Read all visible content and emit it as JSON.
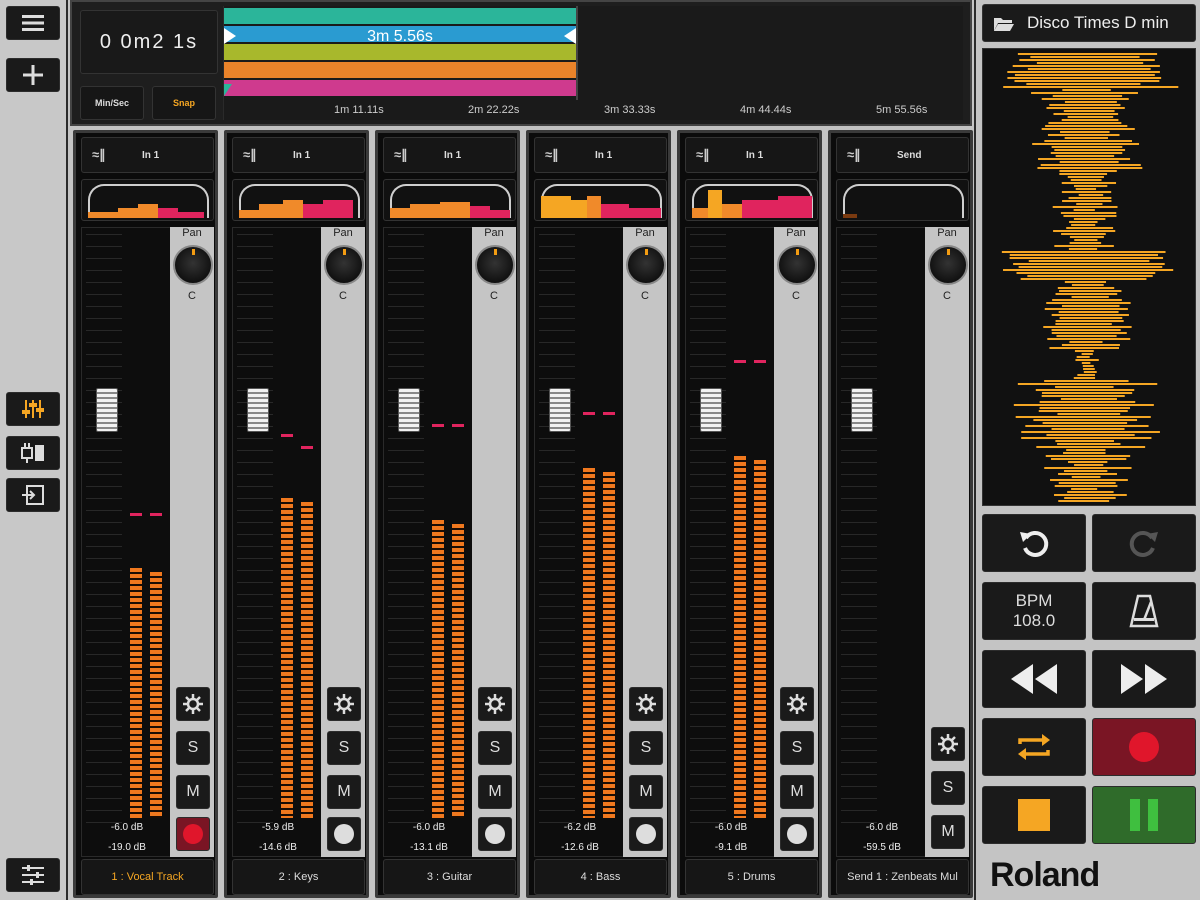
{
  "sidebar": {
    "items": [
      {
        "icon": "hamburger-menu-icon"
      },
      {
        "icon": "plus-icon"
      },
      {
        "icon": "mixer-sliders-icon"
      },
      {
        "icon": "plugin-icon"
      },
      {
        "icon": "export-icon"
      },
      {
        "icon": "list-settings-icon"
      }
    ]
  },
  "transport_time": {
    "display": "0 0m2 1s",
    "min_sec_label": "Min/Sec",
    "snap_label": "Snap"
  },
  "timeline": {
    "selection_label": "3m 5.56s",
    "ticks": [
      "1m 11.11s",
      "2m 22.22s",
      "3m 33.33s",
      "4m 44.44s",
      "5m 55.56s"
    ],
    "clip_colors": [
      "#2bb59a",
      "#2a9bd1",
      "#a8b82c",
      "#e9832a",
      "#cf3a8e"
    ]
  },
  "channels": [
    {
      "input": "In 1",
      "name": "1 : Vocal Track",
      "pan_label": "Pan",
      "pan_value": "C",
      "peak_db": "-6.0 dB",
      "level_db": "-19.0 dB",
      "armed": true,
      "name_color": "#f5a623"
    },
    {
      "input": "In 1",
      "name": "2 : Keys",
      "pan_label": "Pan",
      "pan_value": "C",
      "peak_db": "-5.9 dB",
      "level_db": "-14.6 dB",
      "armed": false,
      "name_color": "#dddddd"
    },
    {
      "input": "In 1",
      "name": "3 : Guitar",
      "pan_label": "Pan",
      "pan_value": "C",
      "peak_db": "-6.0 dB",
      "level_db": "-13.1 dB",
      "armed": false,
      "name_color": "#dddddd"
    },
    {
      "input": "In 1",
      "name": "4 : Bass",
      "pan_label": "Pan",
      "pan_value": "C",
      "peak_db": "-6.2 dB",
      "level_db": "-12.6 dB",
      "armed": false,
      "name_color": "#dddddd"
    },
    {
      "input": "In 1",
      "name": "5 : Drums",
      "pan_label": "Pan",
      "pan_value": "C",
      "peak_db": "-6.0 dB",
      "level_db": "-9.1 dB",
      "armed": false,
      "name_color": "#dddddd"
    },
    {
      "input": "Send",
      "name": "Send 1 : Zenbeats Mul",
      "pan_label": "Pan",
      "pan_value": "C",
      "peak_db": "-6.0 dB",
      "level_db": "-59.5 dB",
      "armed": null,
      "name_color": "#dddddd"
    }
  ],
  "channel_buttons": {
    "solo": "S",
    "mute": "M"
  },
  "right_panel": {
    "song_title": "Disco Times D min",
    "bpm_label": "BPM",
    "bpm_value": "108.0",
    "brand": "Roland"
  },
  "colors": {
    "accent_orange": "#f5a623",
    "record_red": "#e0162b",
    "play_green": "#3fbf3f",
    "meter_orange": "#f08a2a",
    "peak_pink": "#e0245e"
  }
}
